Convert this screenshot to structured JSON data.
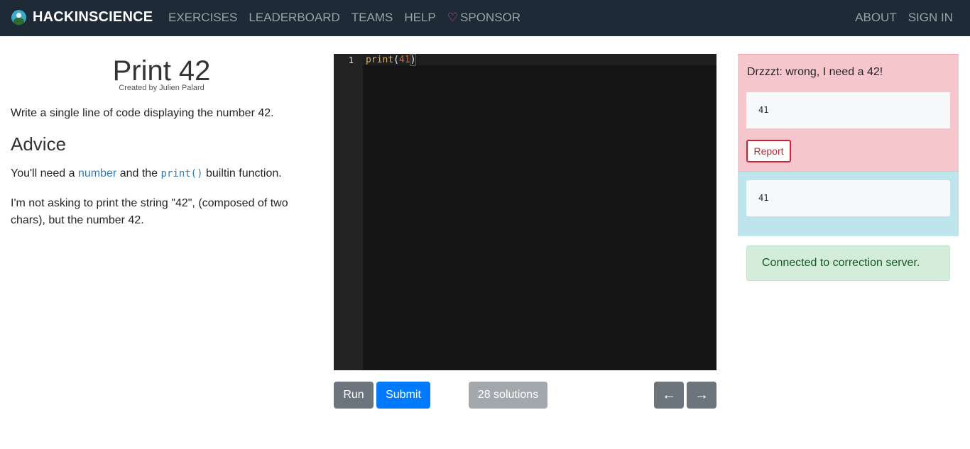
{
  "navbar": {
    "brand": "HACKINSCIENCE",
    "links": [
      "EXERCISES",
      "LEADERBOARD",
      "TEAMS",
      "HELP"
    ],
    "sponsor_icon": "heart-icon",
    "sponsor": "SPONSOR",
    "right_links": [
      "ABOUT",
      "SIGN IN"
    ]
  },
  "exercise": {
    "title": "Print 42",
    "author": "Created by Julien Palard",
    "description": "Write a single line of code displaying the number 42.",
    "advice_heading": "Advice",
    "advice_1_pre": "You'll need a ",
    "advice_1_link": "number",
    "advice_1_mid": " and the ",
    "advice_1_code": "print()",
    "advice_1_post": " builtin function.",
    "advice_2": "I'm not asking to print the string \"42\", (composed of two chars), but the number 42."
  },
  "editor": {
    "line_number": "1",
    "code_fn": "print",
    "code_open": "(",
    "code_arg": "41",
    "code_close": ")"
  },
  "actions": {
    "run": "Run",
    "submit": "Submit",
    "solutions": "28 solutions",
    "prev": "←",
    "next": "→"
  },
  "result": {
    "error_message": "Drzzzt: wrong, I need a 42!",
    "error_output": "41",
    "report": "Report",
    "stdout": "41",
    "status": "Connected to correction server."
  },
  "colors": {
    "navbar_bg": "#1e2a35",
    "primary": "#007bff",
    "secondary": "#6c757d",
    "danger_bg": "#f5c6cb",
    "info_bg": "#bee5eb",
    "success_bg": "#d4edda"
  }
}
